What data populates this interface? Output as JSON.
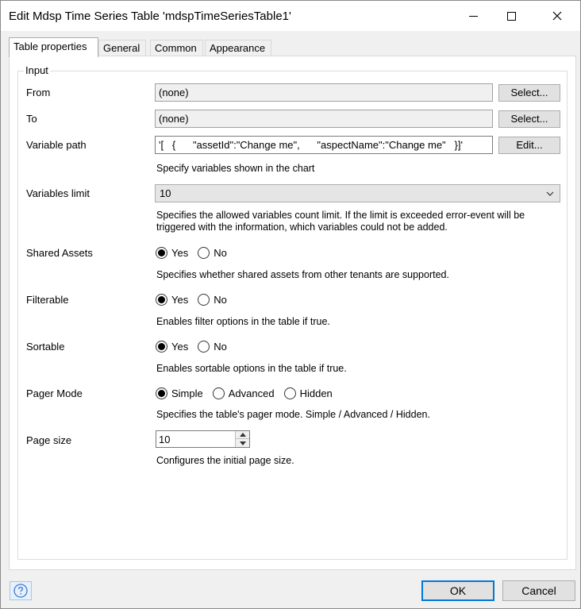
{
  "window": {
    "title": "Edit Mdsp Time Series Table 'mdspTimeSeriesTable1'"
  },
  "tabs": [
    {
      "label": "Table properties",
      "active": true
    },
    {
      "label": "General"
    },
    {
      "label": "Common"
    },
    {
      "label": "Appearance"
    }
  ],
  "group": {
    "legend": "Input"
  },
  "from": {
    "label": "From",
    "value": "(none)",
    "button": "Select..."
  },
  "to": {
    "label": "To",
    "value": "(none)",
    "button": "Select..."
  },
  "variable_path": {
    "label": "Variable path",
    "value": "'[   {      \"assetId\":\"Change me\",      \"aspectName\":\"Change me\"   }]'",
    "button": "Edit...",
    "help": "Specify variables shown in the chart"
  },
  "variables_limit": {
    "label": "Variables limit",
    "value": "10",
    "help": "Specifies the allowed variables count limit. If the limit is exceeded error-event will be triggered with the information, which variables could not be added."
  },
  "shared_assets": {
    "label": "Shared Assets",
    "options": [
      "Yes",
      "No"
    ],
    "selected": "Yes",
    "help": "Specifies whether shared assets from other tenants are supported."
  },
  "filterable": {
    "label": "Filterable",
    "options": [
      "Yes",
      "No"
    ],
    "selected": "Yes",
    "help": "Enables filter options in the table if true."
  },
  "sortable": {
    "label": "Sortable",
    "options": [
      "Yes",
      "No"
    ],
    "selected": "Yes",
    "help": "Enables sortable options in the table if true."
  },
  "pager_mode": {
    "label": "Pager Mode",
    "options": [
      "Simple",
      "Advanced",
      "Hidden"
    ],
    "selected": "Simple",
    "help": "Specifies the table's pager mode.  Simple / Advanced / Hidden."
  },
  "page_size": {
    "label": "Page size",
    "value": "10",
    "help": "Configures the initial page size."
  },
  "footer": {
    "ok": "OK",
    "cancel": "Cancel"
  },
  "colors": {
    "accent": "#0078d7",
    "help_icon": "#3a7bd5"
  }
}
